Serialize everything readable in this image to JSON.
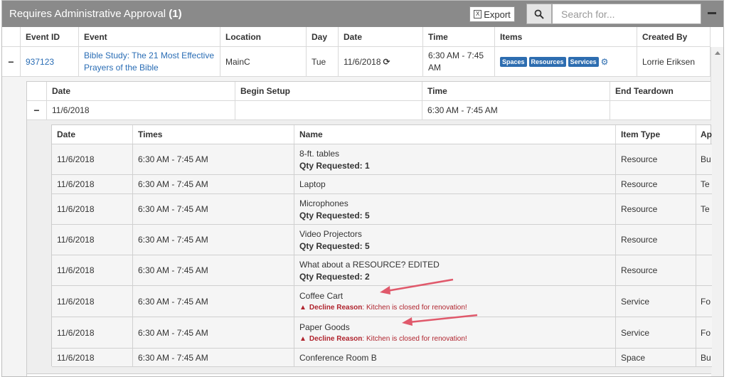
{
  "header": {
    "title": "Requires Administrative Approval",
    "count": "(1)",
    "export_label": "Export",
    "search_placeholder": "Search for..."
  },
  "grid": {
    "columns": [
      "Event ID",
      "Event",
      "Location",
      "Day",
      "Date",
      "Time",
      "Items",
      "Created By"
    ],
    "row": {
      "event_id": "937123",
      "event_line1": "Bible Study: The 21 Most Effective",
      "event_line2": "Prayers of the Bible",
      "location": "MainC",
      "day": "Tue",
      "date": "11/6/2018",
      "time_line1": "6:30 AM - 7:45",
      "time_line2": "AM",
      "badges": [
        "Spaces",
        "Resources",
        "Services"
      ],
      "created_by": "Lorrie Eriksen"
    }
  },
  "schedule": {
    "columns": [
      "Date",
      "Begin Setup",
      "Time",
      "End Teardown"
    ],
    "row": {
      "date": "11/6/2018",
      "begin_setup": "",
      "time": "6:30 AM - 7:45 AM",
      "end_teardown": ""
    }
  },
  "items": {
    "columns": [
      "Date",
      "Times",
      "Name",
      "Item Type",
      "Ap"
    ],
    "qty_label": "Qty Requested:",
    "decline_label": "Decline Reason",
    "rows": [
      {
        "date": "11/6/2018",
        "times": "6:30 AM - 7:45 AM",
        "name": "8-ft. tables",
        "qty": "1",
        "type": "Resource",
        "ap": "Bu"
      },
      {
        "date": "11/6/2018",
        "times": "6:30 AM - 7:45 AM",
        "name": "Laptop",
        "type": "Resource",
        "ap": "Te"
      },
      {
        "date": "11/6/2018",
        "times": "6:30 AM - 7:45 AM",
        "name": "Microphones",
        "qty": "5",
        "type": "Resource",
        "ap": "Te"
      },
      {
        "date": "11/6/2018",
        "times": "6:30 AM - 7:45 AM",
        "name": "Video Projectors",
        "qty": "5",
        "type": "Resource",
        "ap": ""
      },
      {
        "date": "11/6/2018",
        "times": "6:30 AM - 7:45 AM",
        "name": "What about a RESOURCE? EDITED",
        "qty": "2",
        "type": "Resource",
        "ap": ""
      },
      {
        "date": "11/6/2018",
        "times": "6:30 AM - 7:45 AM",
        "name": "Coffee Cart",
        "decline": ": Kitchen is closed for renovation!",
        "type": "Service",
        "ap": "Fo"
      },
      {
        "date": "11/6/2018",
        "times": "6:30 AM - 7:45 AM",
        "name": "Paper Goods",
        "decline": ": Kitchen is closed for renovation!",
        "type": "Service",
        "ap": "Fo"
      },
      {
        "date": "11/6/2018",
        "times": "6:30 AM - 7:45 AM",
        "name": "Conference Room B",
        "type": "Space",
        "ap": "Bu"
      }
    ]
  },
  "colors": {
    "header_bg": "#8a8a8a",
    "link": "#2a6db5",
    "badge": "#2d6db0",
    "decline": "#b0242e",
    "arrow": "#e0596b"
  }
}
